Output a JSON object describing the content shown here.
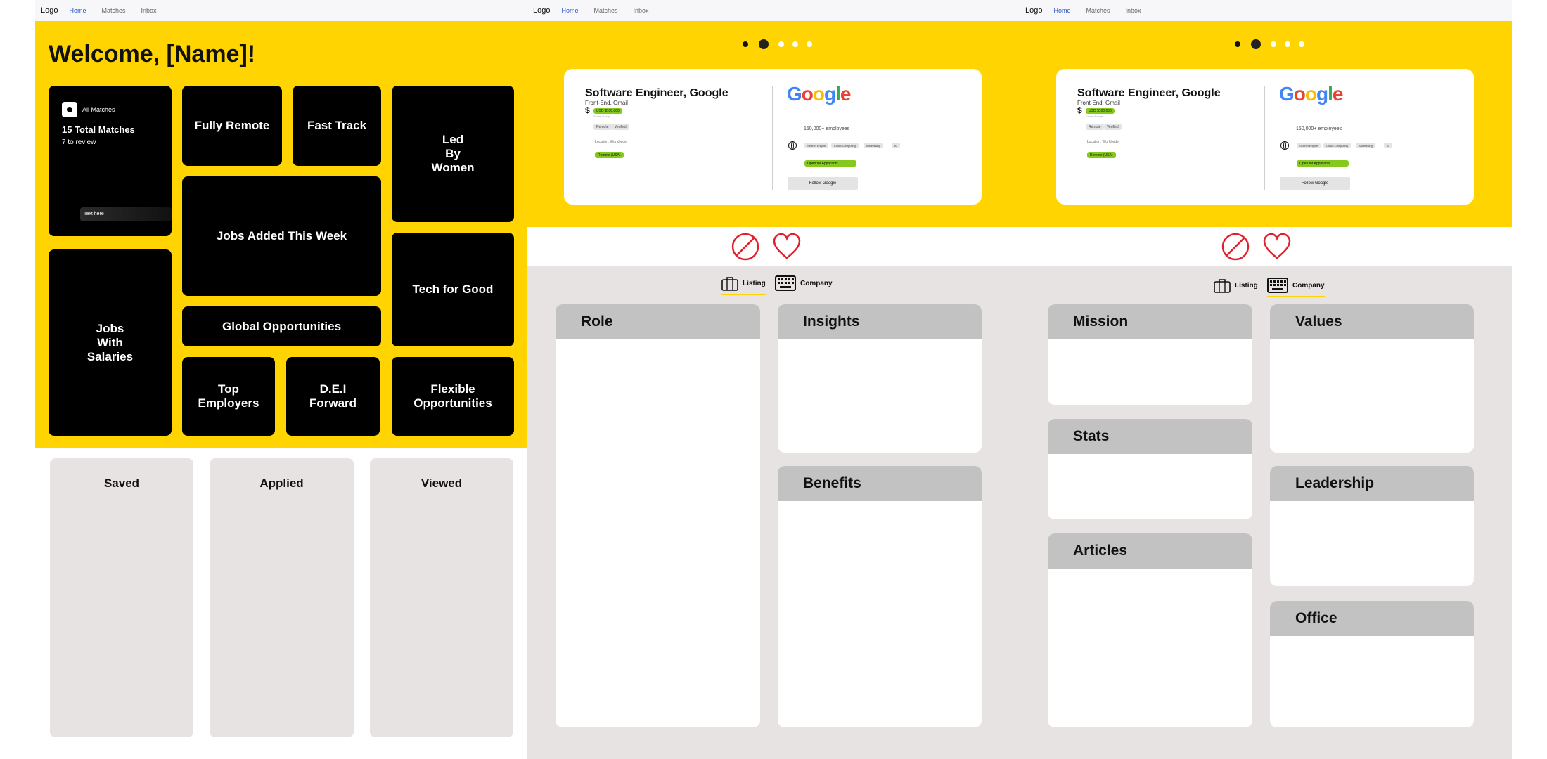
{
  "nav": {
    "logo": "Logo",
    "links": [
      "Home",
      "Matches",
      "Inbox"
    ]
  },
  "home": {
    "welcome": "Welcome, [Name]!",
    "all_matches": {
      "label": "All Matches",
      "total": "15 Total Matches",
      "review": "7 to review",
      "text_here": "Text here"
    },
    "tiles": {
      "fully_remote": "Fully Remote",
      "fast_track": "Fast Track",
      "led_by_women": "Led\nBy\nWomen",
      "jobs_added": "Jobs Added This Week",
      "tech_for_good": "Tech for Good",
      "jobs_with_salaries": "Jobs\nWith\nSalaries",
      "global": "Global Opportunities",
      "top_employers": "Top\nEmployers",
      "dei": "D.E.I\nForward",
      "flexible": "Flexible\nOpportunities"
    },
    "status": [
      "Saved",
      "Applied",
      "Viewed"
    ]
  },
  "job": {
    "title": "Software Engineer, Google",
    "subtitle": "Front-End, Gmail",
    "salary": "USD $100,000",
    "salary_sub": "Salary Range",
    "tags": [
      "Remote",
      "Verified"
    ],
    "location": "Location: Worldwide",
    "remote": "Remote (USA)",
    "employees": "150,000+ employees",
    "industries": [
      "Search Engine",
      "Cloud Computing",
      "Advertising",
      "AI"
    ],
    "open": "Open for Applicants",
    "follow": "Follow Google",
    "logo": "Google"
  },
  "tabs": {
    "listing": "Listing",
    "company": "Company"
  },
  "listing_sections": {
    "role": "Role",
    "insights": "Insights",
    "benefits": "Benefits"
  },
  "company_sections": {
    "mission": "Mission",
    "values": "Values",
    "stats": "Stats",
    "leadership": "Leadership",
    "articles": "Articles",
    "office": "Office"
  },
  "colors": {
    "brand_yellow": "#ffd400",
    "tag_green": "#84c91c",
    "reject_red": "#e0202a",
    "nav_active": "#2a55c9"
  }
}
